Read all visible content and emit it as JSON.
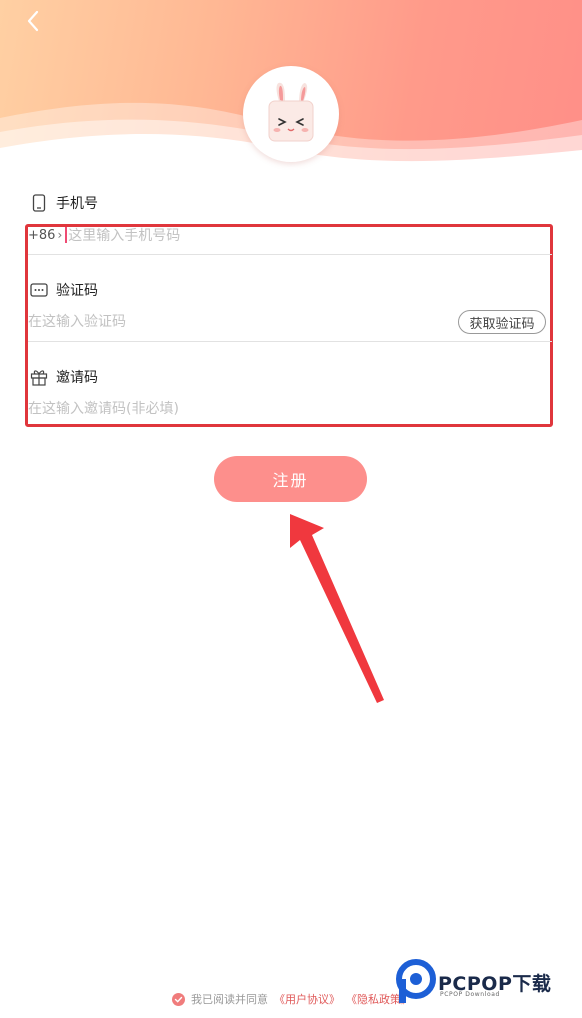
{
  "header": {
    "colors": {
      "start": "#ffd0a3",
      "end": "#ff8f88"
    }
  },
  "form": {
    "phone": {
      "label": "手机号",
      "country_code": "+86",
      "placeholder": "这里输入手机号码"
    },
    "verification": {
      "label": "验证码",
      "placeholder": "在这输入验证码",
      "get_code_button": "获取验证码"
    },
    "invite": {
      "label": "邀请码",
      "placeholder": "在这输入邀请码(非必填)"
    }
  },
  "register_button": {
    "label": "注册",
    "color": "#fd8f8c"
  },
  "agreement": {
    "prefix": "我已阅读并同意",
    "user_agreement": "《用户协议》",
    "privacy_policy": "《隐私政策》"
  },
  "watermark": {
    "brand": "PCPOP下载",
    "sub": "PCPOP Download"
  },
  "annotation": {
    "highlight_color": "#e0363c"
  }
}
